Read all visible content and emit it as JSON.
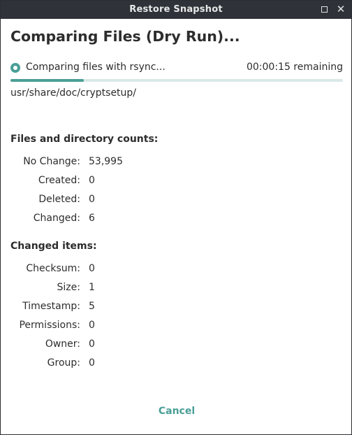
{
  "window": {
    "title": "Restore Snapshot",
    "maximize_icon": "maximize-icon",
    "close_icon": "close-icon",
    "close_glyph": "✕"
  },
  "heading": "Comparing Files (Dry Run)...",
  "status": {
    "text": "Comparing files with rsync...",
    "remaining": "00:00:15 remaining",
    "progress_fraction": 0.22
  },
  "current_path": "usr/share/doc/cryptsetup/",
  "counts": {
    "title": "Files and directory counts:",
    "rows": [
      {
        "label": "No Change:",
        "value": "53,995"
      },
      {
        "label": "Created:",
        "value": "0"
      },
      {
        "label": "Deleted:",
        "value": "0"
      },
      {
        "label": "Changed:",
        "value": "6"
      }
    ]
  },
  "changed_items": {
    "title": "Changed items:",
    "rows": [
      {
        "label": "Checksum:",
        "value": "0"
      },
      {
        "label": "Size:",
        "value": "1"
      },
      {
        "label": "Timestamp:",
        "value": "5"
      },
      {
        "label": "Permissions:",
        "value": "0"
      },
      {
        "label": "Owner:",
        "value": "0"
      },
      {
        "label": "Group:",
        "value": "0"
      }
    ]
  },
  "cancel_label": "Cancel",
  "colors": {
    "accent": "#4a9f96",
    "titlebar": "#2f3339",
    "text": "#2d2d2d"
  }
}
